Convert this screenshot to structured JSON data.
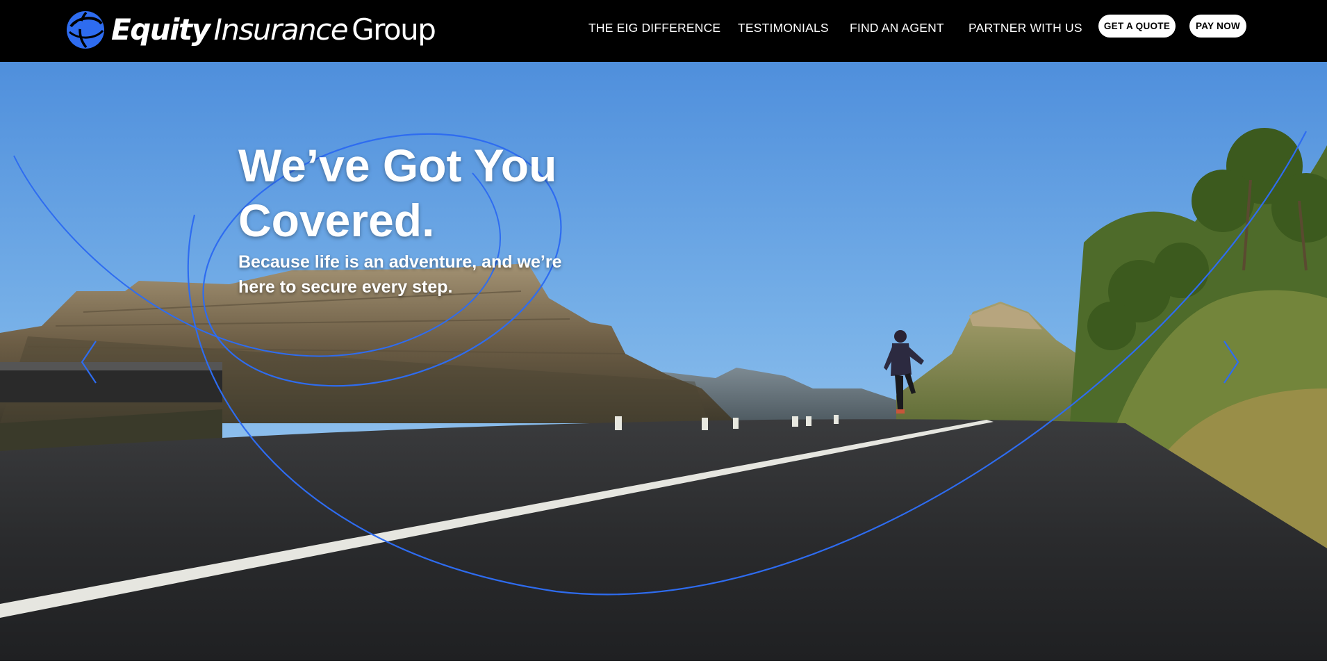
{
  "brand": {
    "name_bold": "Equity",
    "name_mid": "Insurance",
    "name_light": "Group",
    "logo_icon": "globe-swirl-icon",
    "accent_color": "#2e6cf0"
  },
  "nav": {
    "items": [
      {
        "label": "THE EIG DIFFERENCE"
      },
      {
        "label": "TESTIMONIALS"
      },
      {
        "label": "FIND AN AGENT"
      },
      {
        "label": "PARTNER WITH US"
      }
    ],
    "quote_button": "GET A QUOTE",
    "pay_button": "PAY NOW"
  },
  "hero": {
    "title_line1": "We’ve Got You",
    "title_line2": "Covered.",
    "subtitle": "Because life is an adventure, and we’re here to secure every step.",
    "prev_icon": "chevron-left-icon",
    "next_icon": "chevron-right-icon",
    "image_subject": "runner-on-mountain-road"
  }
}
